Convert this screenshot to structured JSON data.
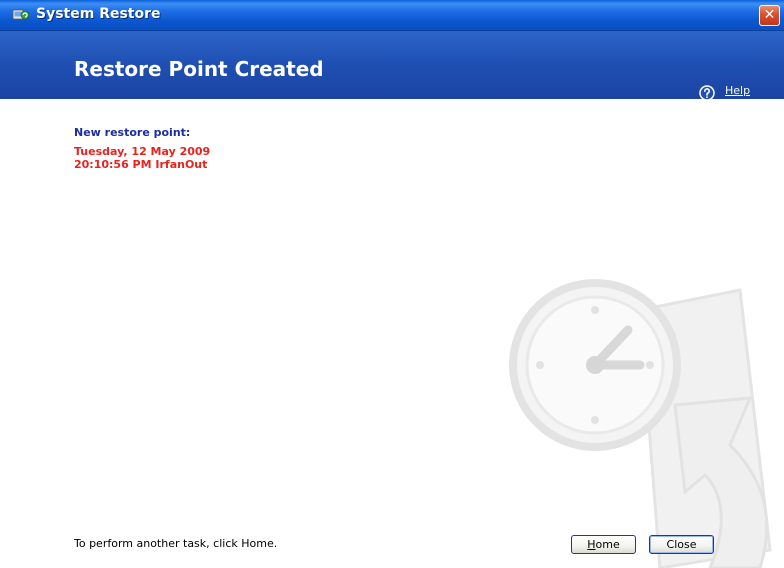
{
  "window": {
    "title": "System Restore",
    "close_glyph": "✕"
  },
  "header": {
    "title": "Restore Point Created",
    "help_label": "Help",
    "help_icon": "question-circle-icon"
  },
  "restore_point": {
    "label": "New restore point:",
    "date": "Tuesday, 12 May 2009",
    "time_and_name": "20:10:56 PM  IrfanOut"
  },
  "footer": {
    "hint": "To perform another task, click Home.",
    "home_button": {
      "accel": "H",
      "rest": "ome"
    },
    "close_button": "Close"
  },
  "colors": {
    "header_blue": "#1f4fb2",
    "label_blue": "#1a2ea0",
    "accent_red": "#e8231e"
  }
}
